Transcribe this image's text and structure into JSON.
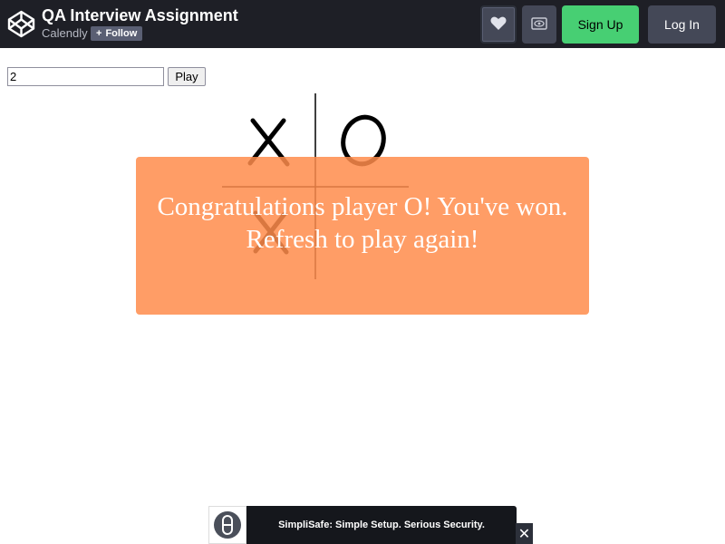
{
  "header": {
    "title": "QA Interview Assignment",
    "author": "Calendly",
    "follow_label": "Follow",
    "follow_icon": "+",
    "heart_icon": "heart-icon",
    "view_icon": "eye-icon",
    "signup_label": "Sign Up",
    "login_label": "Log In"
  },
  "controls": {
    "size_value": "2",
    "play_label": "Play"
  },
  "board": {
    "cells": [
      "X",
      "O",
      "X",
      ""
    ]
  },
  "overlay": {
    "message_line1": "Congratulations player O! You've won.",
    "message_line2": "Refresh to play again!"
  },
  "ad": {
    "text": "SimpliSafe: Simple Setup. Serious Security.",
    "close_label": "✕"
  },
  "colors": {
    "header_bg": "#1e1f26",
    "signup_bg": "#47cf73",
    "overlay_bg": "#ff8c4b"
  }
}
